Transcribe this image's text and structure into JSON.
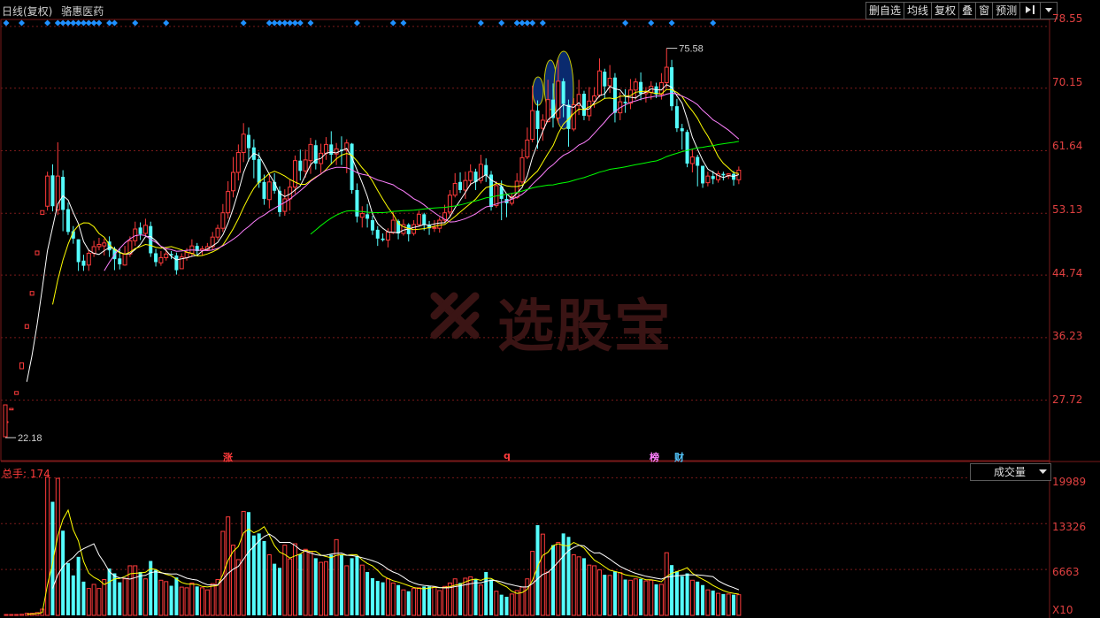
{
  "header": {
    "period": "日线(复权)",
    "stock_name": "骆惠医药"
  },
  "toolbar": {
    "buttons": [
      "删自选",
      "均线",
      "复权",
      "叠",
      "窗",
      "预测"
    ],
    "pin_icon": "pin-right-icon",
    "dropdown_icon": "triangle-down-icon"
  },
  "price_axis": {
    "ticks": [
      "78.55",
      "70.15",
      "61.64",
      "53.13",
      "44.74",
      "36.23",
      "27.72"
    ]
  },
  "annotations": {
    "high_label": "75.58",
    "low_label": "22.18"
  },
  "event_markers": {
    "zhang": "涨",
    "q": "q",
    "bang": "榜",
    "cai": "财"
  },
  "volume_panel": {
    "label": "总手: 174",
    "indicator": "成交量",
    "ticks": [
      "19989",
      "13326",
      "6663"
    ],
    "unit": "X10"
  },
  "watermark": {
    "text": "选股宝"
  },
  "colors": {
    "up": "#ff3b3b",
    "down": "#54fcfc",
    "grid": "#7a1a1a",
    "ma5": "#ffffff",
    "ma10": "#ffff00",
    "ma20": "#ff80ff",
    "ma60": "#00ff00",
    "diamond": "#1e90ff"
  },
  "chart_data": {
    "type": "candlestick",
    "price_range": [
      19.5,
      79.5
    ],
    "volume_range": [
      0,
      19989
    ],
    "candles": [
      [
        24.8,
        24.8,
        24.8,
        24.8,
        120
      ],
      [
        26.4,
        26.6,
        26.6,
        26.4,
        120
      ],
      [
        28.5,
        28.9,
        28.9,
        28.5,
        120
      ],
      [
        32.0,
        32.8,
        32.8,
        32.0,
        150
      ],
      [
        37.5,
        38.0,
        38.0,
        37.5,
        300
      ],
      [
        42.0,
        42.5,
        42.5,
        42.0,
        300
      ],
      [
        47.5,
        48.0,
        48.0,
        47.5,
        400
      ],
      [
        53.0,
        53.5,
        53.5,
        53.0,
        900
      ],
      [
        54.1,
        58.2,
        58.8,
        53.5,
        20100
      ],
      [
        58.3,
        54.1,
        59.8,
        53.4,
        16500
      ],
      [
        53.6,
        58.2,
        62.8,
        52.9,
        19900
      ],
      [
        58.1,
        53.6,
        59.0,
        50.7,
        12300
      ],
      [
        53.7,
        50.6,
        54.6,
        50.2,
        7600
      ],
      [
        50.7,
        49.7,
        51.4,
        49.0,
        5800
      ],
      [
        49.6,
        46.5,
        49.6,
        45.3,
        8500
      ],
      [
        46.7,
        46.0,
        47.5,
        45.3,
        4900
      ],
      [
        46.1,
        47.7,
        48.2,
        45.3,
        3900
      ],
      [
        47.7,
        48.6,
        49.4,
        47.2,
        4500
      ],
      [
        48.6,
        48.9,
        49.8,
        48.1,
        3900
      ],
      [
        48.7,
        49.1,
        49.7,
        47.4,
        5200
      ],
      [
        49.3,
        48.1,
        50.0,
        47.2,
        6800
      ],
      [
        48.3,
        46.9,
        48.6,
        45.4,
        6100
      ],
      [
        47.0,
        46.2,
        48.3,
        45.5,
        4800
      ],
      [
        46.1,
        47.6,
        48.7,
        46.0,
        5300
      ],
      [
        47.6,
        49.4,
        50.0,
        47.2,
        7200
      ],
      [
        49.4,
        51.0,
        52.0,
        48.7,
        7200
      ],
      [
        51.2,
        50.3,
        51.9,
        49.5,
        6300
      ],
      [
        50.4,
        51.5,
        52.4,
        50.1,
        5300
      ],
      [
        51.4,
        47.7,
        52.0,
        47.2,
        7900
      ],
      [
        47.7,
        46.5,
        48.3,
        45.9,
        6600
      ],
      [
        46.4,
        47.1,
        48.0,
        46.0,
        5100
      ],
      [
        47.1,
        47.6,
        48.4,
        46.7,
        4900
      ],
      [
        47.6,
        47.4,
        48.0,
        46.9,
        4300
      ],
      [
        47.4,
        45.4,
        47.8,
        44.8,
        5500
      ],
      [
        45.6,
        47.2,
        47.7,
        45.6,
        4100
      ],
      [
        47.1,
        47.8,
        48.4,
        46.7,
        4000
      ],
      [
        47.7,
        48.7,
        49.6,
        47.2,
        4700
      ],
      [
        48.7,
        48.0,
        49.1,
        47.4,
        4200
      ],
      [
        48.1,
        48.3,
        48.7,
        47.4,
        4000
      ],
      [
        48.2,
        48.6,
        49.1,
        48.0,
        3700
      ],
      [
        48.6,
        49.9,
        50.6,
        48.2,
        4600
      ],
      [
        49.9,
        51.1,
        51.6,
        49.5,
        5200
      ],
      [
        51.1,
        53.2,
        54.4,
        50.6,
        12200
      ],
      [
        53.2,
        56.1,
        57.5,
        52.4,
        14300
      ],
      [
        56.2,
        58.7,
        60.8,
        55.3,
        10200
      ],
      [
        58.7,
        61.4,
        62.5,
        57.6,
        8100
      ],
      [
        61.4,
        63.9,
        65.4,
        60.1,
        15100
      ],
      [
        63.8,
        62.0,
        64.8,
        60.2,
        15000
      ],
      [
        62.1,
        60.4,
        63.2,
        57.9,
        11600
      ],
      [
        60.5,
        57.3,
        61.4,
        56.6,
        11900
      ],
      [
        57.4,
        55.1,
        58.4,
        54.3,
        10800
      ],
      [
        55.0,
        57.4,
        58.3,
        53.8,
        8800
      ],
      [
        57.4,
        56.2,
        58.6,
        55.8,
        7500
      ],
      [
        56.2,
        53.3,
        56.8,
        52.7,
        6900
      ],
      [
        53.4,
        55.1,
        56.4,
        52.8,
        10200
      ],
      [
        55.1,
        56.7,
        57.8,
        53.5,
        8200
      ],
      [
        56.7,
        60.3,
        61.0,
        55.8,
        10400
      ],
      [
        60.3,
        58.9,
        61.8,
        57.6,
        8900
      ],
      [
        58.9,
        60.4,
        61.8,
        58.0,
        9600
      ],
      [
        60.3,
        62.5,
        63.4,
        58.5,
        9300
      ],
      [
        62.4,
        59.9,
        63.1,
        59.1,
        8300
      ],
      [
        59.9,
        61.3,
        62.6,
        58.6,
        7700
      ],
      [
        61.3,
        62.5,
        63.5,
        60.4,
        7800
      ],
      [
        62.5,
        61.1,
        64.3,
        59.8,
        8800
      ],
      [
        61.2,
        61.9,
        62.7,
        59.7,
        11000
      ],
      [
        61.8,
        61.6,
        63.6,
        59.7,
        8800
      ],
      [
        61.7,
        62.7,
        63.2,
        58.6,
        7200
      ],
      [
        62.6,
        56.3,
        62.7,
        55.8,
        8300
      ],
      [
        56.3,
        52.7,
        57.2,
        51.9,
        8600
      ],
      [
        52.6,
        53.1,
        54.1,
        51.2,
        7300
      ],
      [
        53.0,
        52.4,
        54.4,
        51.2,
        6300
      ],
      [
        52.2,
        50.8,
        52.8,
        50.2,
        5400
      ],
      [
        50.9,
        49.7,
        51.4,
        48.7,
        5000
      ],
      [
        49.7,
        49.5,
        50.4,
        49.3,
        4800
      ],
      [
        49.5,
        50.6,
        51.1,
        48.5,
        5300
      ],
      [
        50.5,
        52.2,
        53.3,
        50.3,
        4700
      ],
      [
        52.1,
        50.4,
        52.3,
        49.6,
        4400
      ],
      [
        50.4,
        51.6,
        52.3,
        50.1,
        3700
      ],
      [
        51.6,
        50.3,
        51.8,
        49.3,
        3500
      ],
      [
        50.4,
        51.6,
        52.2,
        50.1,
        3900
      ],
      [
        51.6,
        53.0,
        53.5,
        51.3,
        4000
      ],
      [
        53.0,
        51.6,
        53.2,
        50.8,
        4200
      ],
      [
        51.6,
        51.1,
        52.1,
        50.2,
        4200
      ],
      [
        51.1,
        51.2,
        52.2,
        50.6,
        4100
      ],
      [
        51.1,
        52.2,
        52.6,
        50.5,
        3600
      ],
      [
        52.2,
        53.2,
        54.3,
        51.8,
        4200
      ],
      [
        53.3,
        55.6,
        56.3,
        52.6,
        4700
      ],
      [
        55.6,
        57.2,
        58.6,
        55.3,
        5300
      ],
      [
        57.4,
        56.3,
        58.7,
        55.9,
        4700
      ],
      [
        56.3,
        57.6,
        58.8,
        55.1,
        5400
      ],
      [
        57.6,
        58.8,
        59.8,
        56.9,
        5600
      ],
      [
        58.8,
        57.4,
        59.2,
        56.3,
        5300
      ],
      [
        57.6,
        59.8,
        61.1,
        57.2,
        4400
      ],
      [
        59.7,
        58.3,
        60.6,
        57.4,
        6300
      ],
      [
        58.4,
        54.0,
        58.9,
        53.5,
        5200
      ],
      [
        54.2,
        56.9,
        57.5,
        53.9,
        3500
      ],
      [
        56.8,
        55.1,
        57.6,
        52.2,
        3000
      ],
      [
        55.1,
        54.5,
        55.8,
        52.6,
        2700
      ],
      [
        54.5,
        55.4,
        55.9,
        54.2,
        3100
      ],
      [
        55.3,
        57.5,
        58.6,
        55.1,
        3600
      ],
      [
        57.4,
        60.7,
        61.9,
        57.1,
        4100
      ],
      [
        60.8,
        63.1,
        64.8,
        60.5,
        5300
      ],
      [
        63.2,
        67.1,
        70.5,
        62.8,
        9300
      ],
      [
        67.1,
        64.6,
        68.5,
        61.9,
        13100
      ],
      [
        64.7,
        65.8,
        66.6,
        63.0,
        11800
      ],
      [
        65.6,
        68.6,
        71.3,
        65.5,
        6300
      ],
      [
        68.6,
        66.1,
        70.8,
        64.8,
        10200
      ],
      [
        66.1,
        71.1,
        74.0,
        65.4,
        10600
      ],
      [
        71.1,
        68.0,
        71.5,
        66.2,
        11900
      ],
      [
        67.9,
        64.6,
        68.6,
        62.2,
        11400
      ],
      [
        64.6,
        67.9,
        68.8,
        64.3,
        8800
      ],
      [
        67.8,
        69.3,
        71.3,
        66.5,
        8500
      ],
      [
        69.4,
        66.4,
        69.8,
        65.8,
        8300
      ],
      [
        66.4,
        68.4,
        70.3,
        65.7,
        7300
      ],
      [
        68.4,
        69.1,
        70.3,
        67.5,
        7200
      ],
      [
        69.2,
        72.5,
        74.2,
        68.9,
        6600
      ],
      [
        72.4,
        70.4,
        72.8,
        68.7,
        5900
      ],
      [
        70.5,
        71.5,
        73.3,
        69.5,
        5800
      ],
      [
        71.6,
        66.8,
        72.2,
        65.5,
        6400
      ],
      [
        66.8,
        68.3,
        69.6,
        65.8,
        6200
      ],
      [
        68.3,
        68.1,
        70.0,
        66.8,
        5200
      ],
      [
        68.1,
        69.9,
        71.4,
        67.3,
        5100
      ],
      [
        69.9,
        71.0,
        71.5,
        68.6,
        5300
      ],
      [
        71.0,
        69.4,
        72.3,
        68.5,
        5300
      ],
      [
        69.4,
        69.6,
        70.3,
        68.2,
        5000
      ],
      [
        69.6,
        70.4,
        71.1,
        68.6,
        5100
      ],
      [
        70.4,
        69.3,
        70.9,
        68.8,
        4500
      ],
      [
        69.3,
        70.9,
        72.2,
        68.6,
        4500
      ],
      [
        70.9,
        73.0,
        75.58,
        70.2,
        9100
      ],
      [
        73.0,
        67.7,
        74.0,
        67.1,
        7300
      ],
      [
        67.7,
        64.7,
        68.7,
        64.2,
        6400
      ],
      [
        64.7,
        64.3,
        65.3,
        61.8,
        5700
      ],
      [
        64.2,
        59.9,
        64.5,
        59.4,
        6100
      ],
      [
        59.9,
        60.8,
        61.8,
        58.7,
        5100
      ],
      [
        60.8,
        59.6,
        61.1,
        56.8,
        4900
      ],
      [
        59.6,
        57.2,
        59.6,
        56.6,
        4400
      ],
      [
        57.3,
        58.2,
        58.8,
        56.8,
        3700
      ],
      [
        58.2,
        57.8,
        58.9,
        57.1,
        3600
      ],
      [
        57.7,
        58.5,
        58.9,
        57.3,
        3200
      ],
      [
        58.5,
        58.3,
        58.8,
        57.6,
        3100
      ],
      [
        58.3,
        58.5,
        58.6,
        57.8,
        3100
      ],
      [
        58.5,
        57.7,
        58.9,
        56.9,
        3000
      ],
      [
        57.7,
        59.0,
        59.5,
        57.1,
        3000
      ]
    ],
    "ma5": [],
    "ma10": [],
    "ma20": [],
    "ma60": []
  }
}
